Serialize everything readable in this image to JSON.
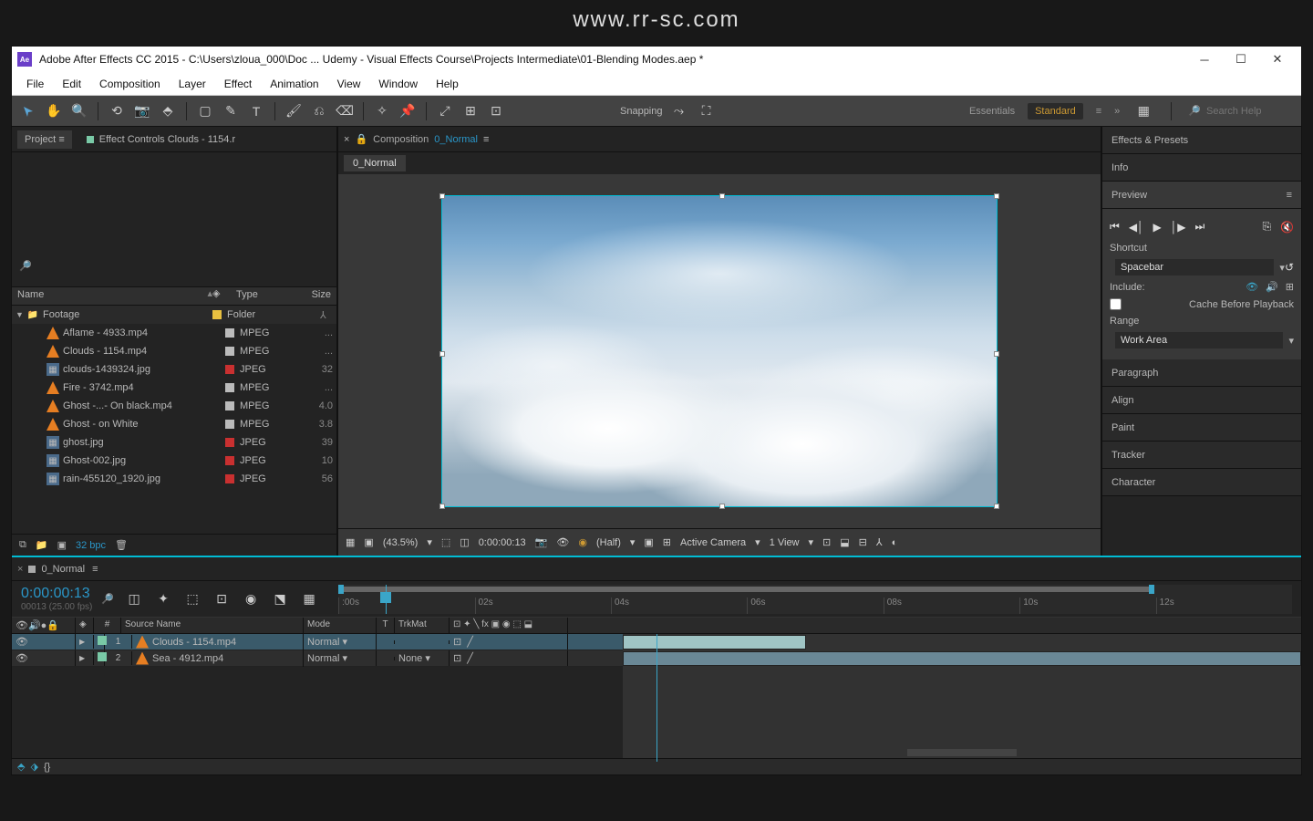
{
  "watermark": "www.rr-sc.com",
  "titlebar": {
    "app_icon_text": "Ae",
    "title": "Adobe After Effects CC 2015 - C:\\Users\\zloua_000\\Doc ... Udemy - Visual Effects Course\\Projects Intermediate\\01-Blending Modes.aep *"
  },
  "menu": [
    "File",
    "Edit",
    "Composition",
    "Layer",
    "Effect",
    "Animation",
    "View",
    "Window",
    "Help"
  ],
  "toolbar": {
    "snapping": "Snapping"
  },
  "workspaces": {
    "essentials": "Essentials",
    "standard": "Standard",
    "search_placeholder": "Search Help"
  },
  "project_panel": {
    "tab_project": "Project",
    "tab_effect_controls": "Effect Controls Clouds - 1154.r",
    "cols": {
      "name": "Name",
      "type": "Type",
      "size": "Size"
    },
    "folder": "Footage",
    "folder_type": "Folder",
    "files": [
      {
        "icon": "vlc",
        "name": "Aflame - 4933.mp4",
        "swatch": "#bbb",
        "type": "MPEG",
        "size": "..."
      },
      {
        "icon": "vlc",
        "name": "Clouds - 1154.mp4",
        "swatch": "#bbb",
        "type": "MPEG",
        "size": "..."
      },
      {
        "icon": "img",
        "name": "clouds-1439324.jpg",
        "swatch": "#c93030",
        "type": "JPEG",
        "size": "32"
      },
      {
        "icon": "vlc",
        "name": "Fire - 3742.mp4",
        "swatch": "#bbb",
        "type": "MPEG",
        "size": "..."
      },
      {
        "icon": "vlc",
        "name": "Ghost -...- On black.mp4",
        "swatch": "#bbb",
        "type": "MPEG",
        "size": "4.0"
      },
      {
        "icon": "vlc",
        "name": "Ghost - on White",
        "swatch": "#bbb",
        "type": "MPEG",
        "size": "3.8"
      },
      {
        "icon": "img",
        "name": "ghost.jpg",
        "swatch": "#c93030",
        "type": "JPEG",
        "size": "39"
      },
      {
        "icon": "img",
        "name": "Ghost-002.jpg",
        "swatch": "#c93030",
        "type": "JPEG",
        "size": "10"
      },
      {
        "icon": "img",
        "name": "rain-455120_1920.jpg",
        "swatch": "#c93030",
        "type": "JPEG",
        "size": "56"
      }
    ],
    "bpc": "32 bpc"
  },
  "comp": {
    "label": "Composition",
    "name": "0_Normal",
    "tab": "0_Normal",
    "footer": {
      "zoom": "(43.5%)",
      "time": "0:00:00:13",
      "res": "(Half)",
      "camera": "Active Camera",
      "views": "1 View"
    }
  },
  "right": {
    "effects": "Effects & Presets",
    "info": "Info",
    "preview": "Preview",
    "shortcut_label": "Shortcut",
    "shortcut": "Spacebar",
    "include": "Include:",
    "cache": "Cache Before Playback",
    "range_label": "Range",
    "range": "Work Area",
    "paragraph": "Paragraph",
    "align": "Align",
    "paint": "Paint",
    "tracker": "Tracker",
    "character": "Character"
  },
  "timeline": {
    "tab": "0_Normal",
    "timecode": "0:00:00:13",
    "fps": "00013 (25.00 fps)",
    "cols": {
      "num": "#",
      "src": "Source Name",
      "mode": "Mode",
      "t": "T",
      "trk": "TrkMat"
    },
    "marks": [
      ":00s",
      "02s",
      "04s",
      "06s",
      "08s",
      "10s",
      "12s"
    ],
    "layers": [
      {
        "num": "1",
        "name": "Clouds - 1154.mp4",
        "mode": "Normal",
        "trk": "",
        "swatch": "#79c9a6",
        "sel": true
      },
      {
        "num": "2",
        "name": "Sea - 4912.mp4",
        "mode": "Normal",
        "trk": "None",
        "swatch": "#79c9a6",
        "sel": false
      }
    ]
  }
}
